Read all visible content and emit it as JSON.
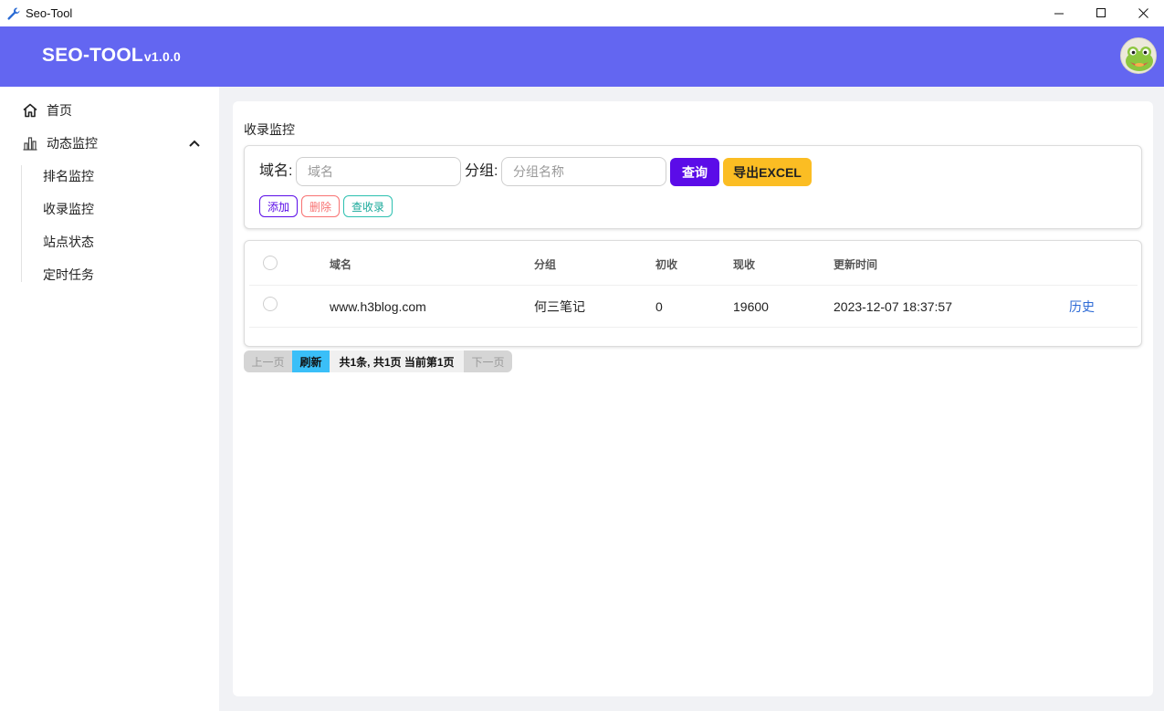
{
  "window": {
    "title": "Seo-Tool"
  },
  "header": {
    "brand": "SEO-TOOL",
    "version": "v1.0.0"
  },
  "sidebar": {
    "items": [
      {
        "label": "首页",
        "icon": "home-icon"
      },
      {
        "label": "动态监控",
        "icon": "bar-chart-icon",
        "expanded": true,
        "children": [
          "排名监控",
          "收录监控",
          "站点状态",
          "定时任务"
        ]
      }
    ]
  },
  "main": {
    "title": "收录监控",
    "filter": {
      "domain_label": "域名:",
      "domain_placeholder": "域名",
      "domain_value": "",
      "group_label": "分组:",
      "group_placeholder": "分组名称",
      "group_value": "",
      "query_button": "查询",
      "export_button": "导出EXCEL",
      "add_button": "添加",
      "delete_button": "删除",
      "check_button": "查收录"
    },
    "table": {
      "columns": [
        "域名",
        "分组",
        "初收",
        "现收",
        "更新时间"
      ],
      "rows": [
        {
          "domain": "www.h3blog.com",
          "group": "何三笔记",
          "initial": "0",
          "current": "19600",
          "updated": "2023-12-07 18:37:57",
          "action": "历史"
        }
      ]
    },
    "pager": {
      "prev": "上一页",
      "refresh": "刷新",
      "info": "共1条, 共1页 当前第1页",
      "next": "下一页"
    }
  },
  "colors": {
    "header_bg": "#6366f1",
    "query_button": "#5b0ce8",
    "export_button": "#fbbd23",
    "refresh_button": "#3abff8",
    "delete": "#f87272",
    "check": "#2cc0b0",
    "history_link": "#2e6bd6"
  }
}
